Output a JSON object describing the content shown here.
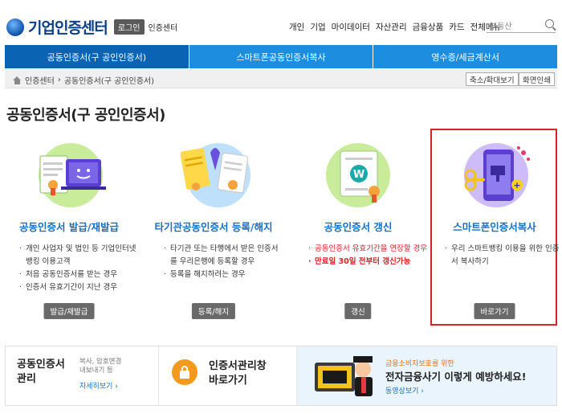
{
  "header": {
    "logo_text": "기업인증센터",
    "login_label": "로그인",
    "center_label": "인증센터",
    "nav": [
      "개인",
      "기업",
      "마이데이터",
      "자산관리",
      "금융상품",
      "카드",
      "전체메뉴"
    ],
    "search_placeholder": "부동산"
  },
  "tabs": [
    {
      "label": "공동인증서(구 공인인증서)",
      "active": true
    },
    {
      "label": "스마트폰공동인증서복사",
      "active": false
    },
    {
      "label": "영수증/세금계산서",
      "active": false
    }
  ],
  "breadcrumb": {
    "items": [
      "인증센터",
      "공동인증서(구 공인인증서)"
    ],
    "separator": "›",
    "zoom_label": "축소/확대보기",
    "print_label": "화면인쇄"
  },
  "page_title": "공동인증서(구 공인인증서)",
  "cards": [
    {
      "title": "공동인증서 발급/재발급",
      "bullets": [
        "개인 사업자 및 법인 등 기업인터넷 뱅킹 이용고객",
        "처음 공동인증서를 받는 경우",
        "인증서 유효기간이 지난 경우"
      ],
      "button": "발급/재발급"
    },
    {
      "title": "타기관공동인증서 등록/해지",
      "bullets": [
        "타기관 또는 타행에서 받은 인증서를 우리은행에 등록할 경우",
        "등록을 해지하려는 경우"
      ],
      "button": "등록/해지"
    },
    {
      "title": "공동인증서 갱신",
      "bullets": [
        "공동인증서 유효기간을 연장할 경우",
        "만료일 30일 전부터 갱신가능"
      ],
      "button": "갱신"
    },
    {
      "title": "스마트폰인증서복사",
      "bullets": [
        "우리 스마트뱅킹 이용을 위한 인증서 복사하기"
      ],
      "button": "바로가기"
    }
  ],
  "bottom": {
    "manage_title_1": "공동인증서",
    "manage_title_2": "관리",
    "manage_desc_1": "복사, 암호변경",
    "manage_desc_2": "내보내기 등",
    "manage_link": "자세히보기 ›",
    "window_title_1": "인증서관리창",
    "window_title_2": "바로가기",
    "promo_small": "금융소비자보호를 위한",
    "promo_title": "전자금융사기 이렇게 예방하세요!",
    "promo_link": "동영상보기 ›"
  },
  "colors": {
    "tab_active": "#0b63b4",
    "tab": "#1d8de0",
    "card_title": "#1a6fc0",
    "warning": "#d9232a"
  }
}
